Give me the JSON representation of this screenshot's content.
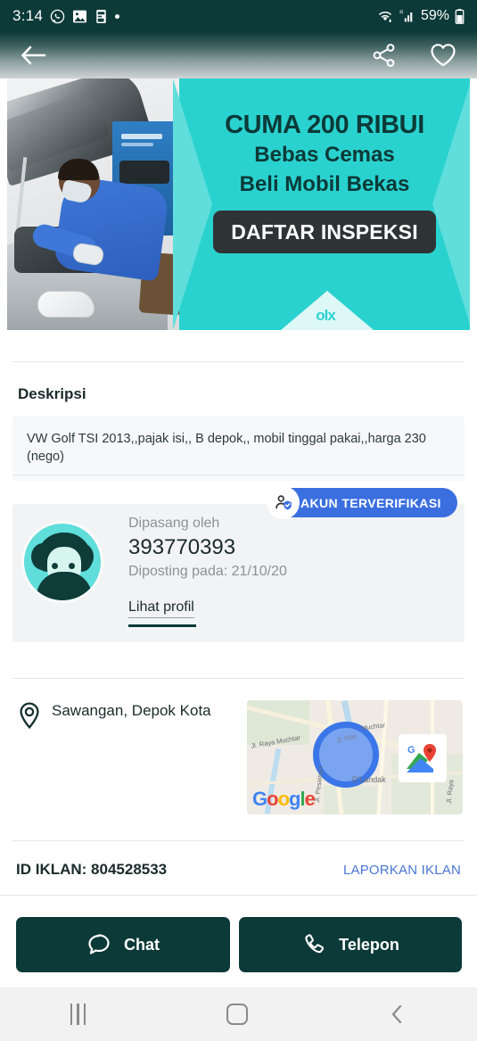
{
  "statusbar": {
    "time": "3:14",
    "icons": [
      "whatsapp-icon",
      "gallery-icon",
      "app-icon",
      "dot-icon"
    ],
    "wifi": "wifi-icon",
    "signal": "signal-bars-icon",
    "roaming": "R",
    "battery_percent": "59%",
    "battery": "battery-icon"
  },
  "appbar": {
    "back": "back-arrow-icon",
    "share": "share-icon",
    "favorite": "heart-icon"
  },
  "banner": {
    "line1": "CUMA 200 RIBUI",
    "line2": "Bebas Cemas",
    "line3": "Beli Mobil Bekas",
    "cta": "DAFTAR INSPEKSI",
    "logo": "olx",
    "bg_color": "#2ad2cf",
    "cta_bg": "#2e3436",
    "text_color": "#0c3a38"
  },
  "description": {
    "title": "Deskripsi",
    "body": "VW Golf TSI 2013,,pajak isi,, B depok,, mobil tinggal pakai,,harga 230 (nego)"
  },
  "seller": {
    "verified_badge": "AKUN TERVERIFIKASI",
    "posted_by_label": "Dipasang oleh",
    "name": "393770393",
    "posted_on": "Diposting pada: 21/10/20",
    "profile_link": "Lihat profil",
    "badge_color": "#3b6fe0",
    "avatar": "user-avatar"
  },
  "location": {
    "address": "Sawangan, Depok Kota",
    "pin": "location-pin-icon",
    "map_labels": {
      "road1": "Jl. Raya Muchtar",
      "road2": "Muchtar",
      "road3": "Jl. Ray",
      "place": "D'Landak",
      "side1": "Jl. Pesainan",
      "side2": "Jl. Raya"
    },
    "map_brand": "Google",
    "map_badge": "google-maps-icon"
  },
  "advert": {
    "id_label": "ID IKLAN: 804528533",
    "report_label": "LAPORKAN IKLAN",
    "report_color": "#4a76d4"
  },
  "actions": {
    "chat_label": "Chat",
    "chat_icon": "chat-bubble-icon",
    "call_label": "Telepon",
    "call_icon": "phone-icon",
    "button_color": "#0c3a38"
  },
  "navbar": {
    "recents": "recents-icon",
    "home": "home-icon",
    "back": "back-chevron-icon"
  }
}
